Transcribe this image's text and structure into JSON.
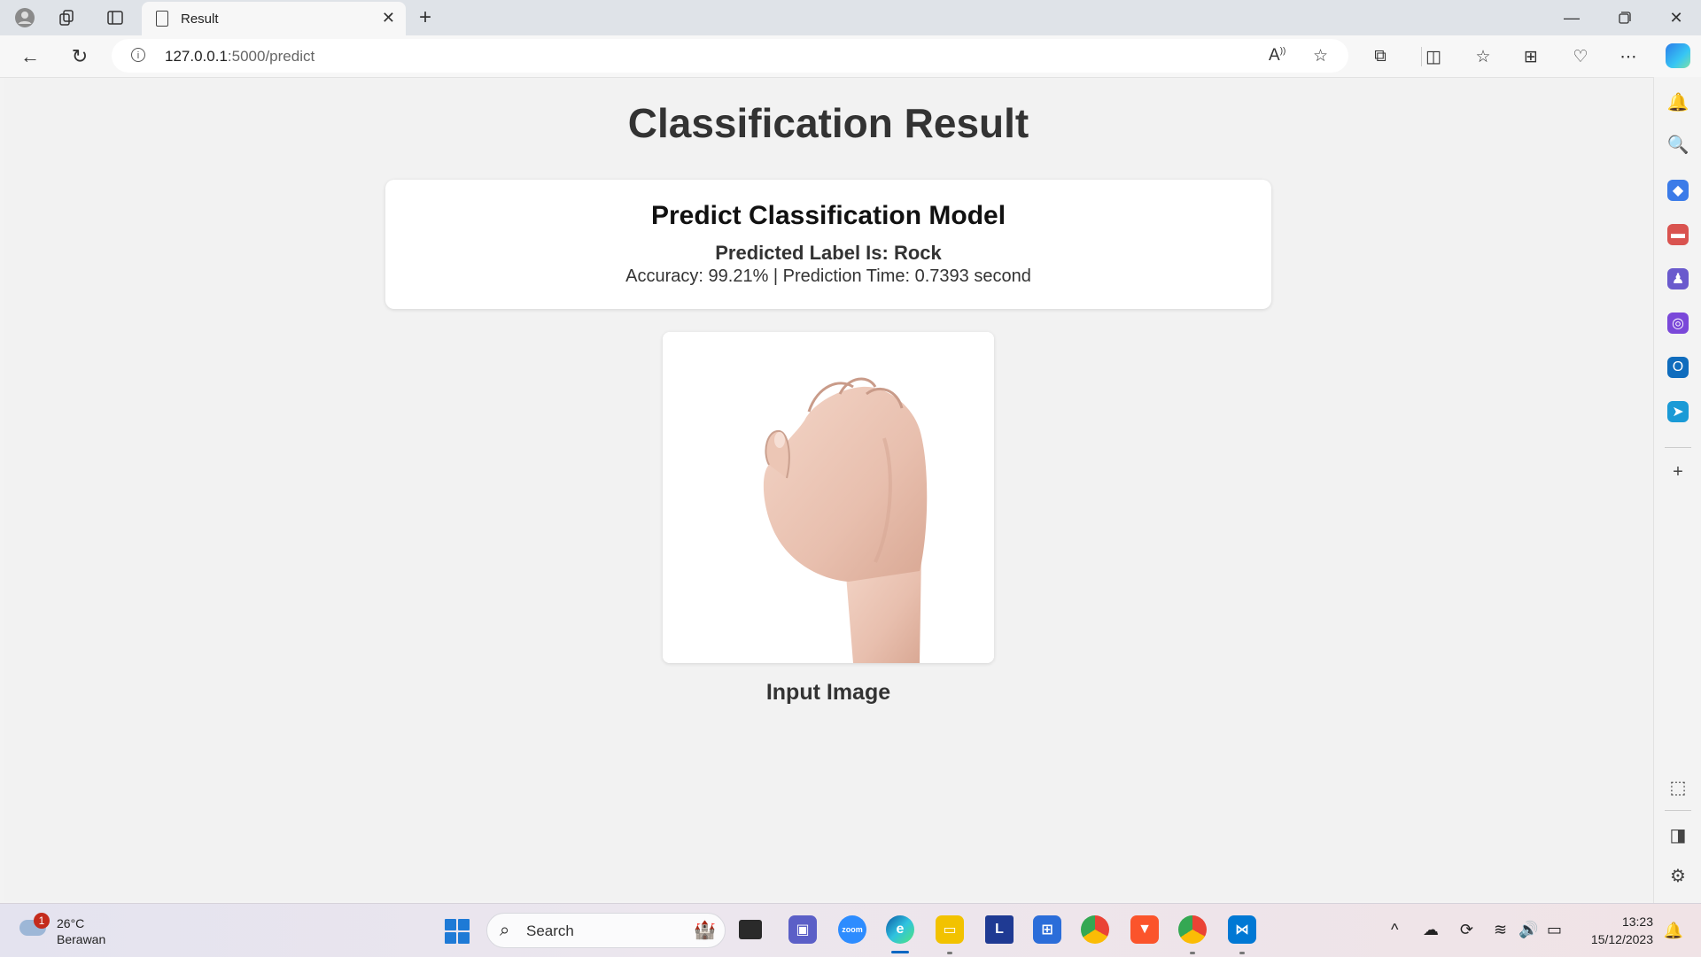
{
  "browser": {
    "tab": {
      "title": "Result"
    },
    "address": {
      "host": "127.0.0.1",
      "path": ":5000/predict"
    }
  },
  "page": {
    "heading": "Classification Result",
    "card": {
      "title": "Predict Classification Model",
      "predicted_label": "Predicted Label Is: Rock",
      "stats": "Accuracy: 99.21% | Prediction Time: 0.7393 second"
    },
    "image_caption": "Input Image"
  },
  "taskbar": {
    "weather": {
      "temp": "26°C",
      "condition": "Berawan",
      "badge": "1"
    },
    "search_placeholder": "Search",
    "clock": {
      "time": "13:23",
      "date": "15/12/2023"
    }
  }
}
